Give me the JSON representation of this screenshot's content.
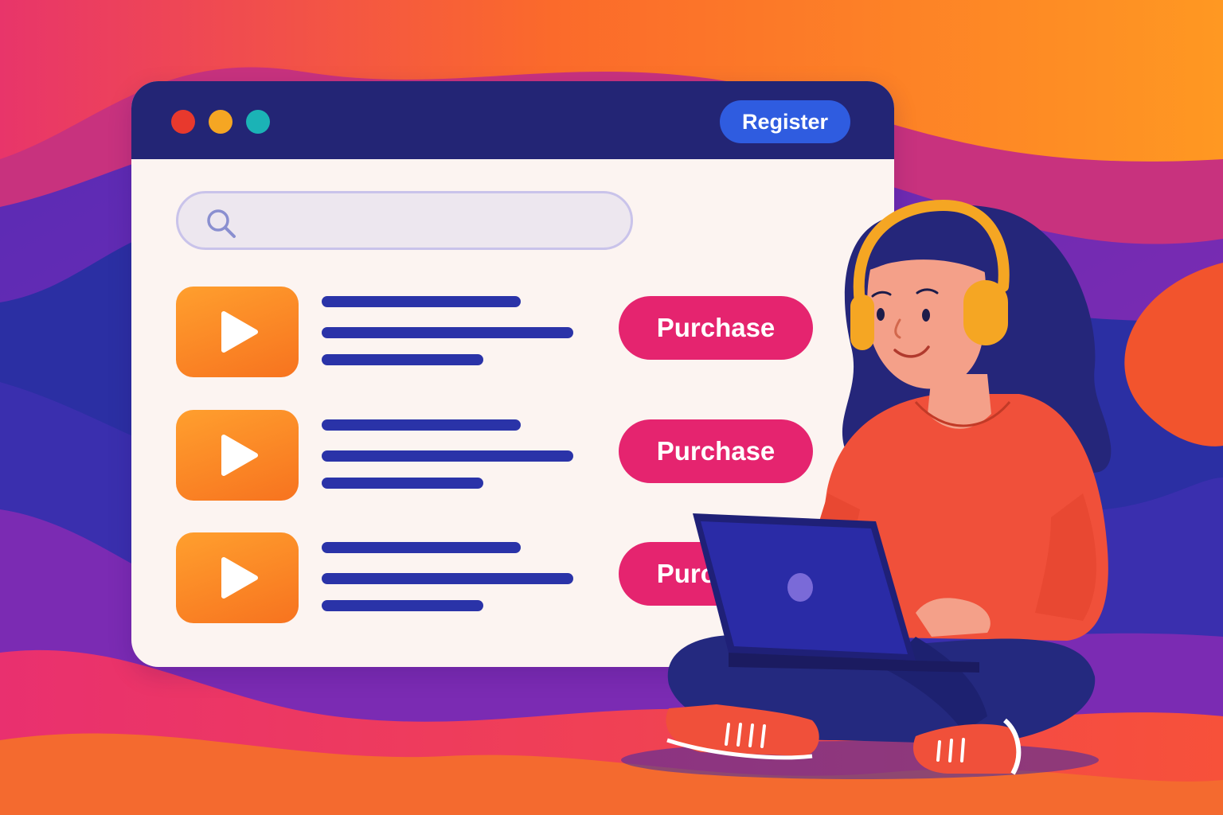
{
  "colors": {
    "accent_blue": "#2f5ce0",
    "accent_pink": "#e5246f",
    "title_bar": "#232575",
    "text_line": "#2a33a8",
    "dot_red": "#e8392d",
    "dot_yellow": "#f5a623",
    "dot_teal": "#1bb3b6"
  },
  "window": {
    "controls": [
      "close-dot",
      "minimize-dot",
      "maximize-dot"
    ],
    "register_label": "Register"
  },
  "search": {
    "icon": "search-icon",
    "value": ""
  },
  "courses": [
    {
      "thumbnail_icon": "play-icon",
      "button_label": "Purchase"
    },
    {
      "thumbnail_icon": "play-icon",
      "button_label": "Purchase"
    },
    {
      "thumbnail_icon": "play-icon",
      "button_label": "Purchase"
    }
  ],
  "illustration": {
    "subject": "woman-with-headphones-using-laptop"
  }
}
